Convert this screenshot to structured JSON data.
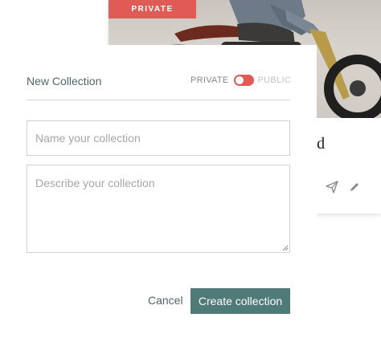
{
  "background_card": {
    "badge": "PRIVATE",
    "title_fragment": "ild",
    "icons": [
      "send-icon",
      "edit-icon"
    ]
  },
  "modal": {
    "title": "New Collection",
    "visibility": {
      "private_label": "PRIVATE",
      "public_label": "PUBLIC",
      "selected": "PRIVATE"
    },
    "name_field": {
      "placeholder": "Name your collection",
      "value": ""
    },
    "description_field": {
      "placeholder": "Describe your collection",
      "value": ""
    },
    "cancel_label": "Cancel",
    "create_label": "Create collection"
  },
  "colors": {
    "accent_red": "#e05a56",
    "primary_teal": "#4f7a78",
    "text_slate": "#50666a"
  }
}
